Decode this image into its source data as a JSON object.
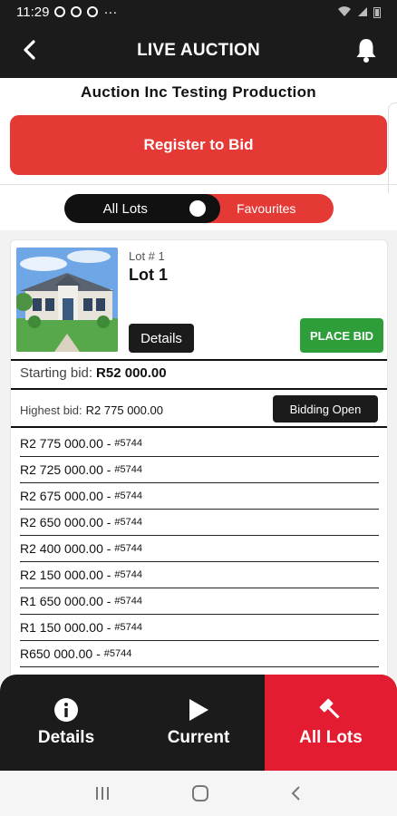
{
  "status_bar": {
    "time": "11:29",
    "more": "···"
  },
  "app_bar": {
    "title": "LIVE AUCTION",
    "back_icon": "back-arrow-icon",
    "bell_icon": "bell-icon"
  },
  "auction_name": "Auction Inc Testing Production",
  "register_button": "Register to Bid",
  "filter_toggle": {
    "left_label": "All Lots",
    "right_label": "Favourites"
  },
  "lot": {
    "number_label": "Lot # 1",
    "name": "Lot 1",
    "details_button": "Details",
    "place_bid_button": "PLACE BID",
    "starting_bid_label": "Starting bid:",
    "starting_bid_value": "R52 000.00",
    "highest_bid_label": "Highest bid:",
    "highest_bid_value": "R2 775 000.00",
    "status_button": "Bidding Open",
    "bids": [
      {
        "amount": "R2 775 000.00",
        "bidder": "#5744"
      },
      {
        "amount": "R2 725 000.00",
        "bidder": "#5744"
      },
      {
        "amount": "R2 675 000.00",
        "bidder": "#5744"
      },
      {
        "amount": "R2 650 000.00",
        "bidder": "#5744"
      },
      {
        "amount": "R2 400 000.00",
        "bidder": "#5744"
      },
      {
        "amount": "R2 150 000.00",
        "bidder": "#5744"
      },
      {
        "amount": "R1 650 000.00",
        "bidder": "#5744"
      },
      {
        "amount": "R1 150 000.00",
        "bidder": "#5744"
      },
      {
        "amount": "R650 000.00",
        "bidder": "#5744"
      }
    ]
  },
  "bottom_nav": [
    {
      "label": "Details",
      "icon": "info-icon",
      "active": false
    },
    {
      "label": "Current",
      "icon": "play-icon",
      "active": false
    },
    {
      "label": "All Lots",
      "icon": "gavel-icon",
      "active": true
    }
  ],
  "colors": {
    "accent_red": "#e53935",
    "dark": "#1b1b1b",
    "green": "#2e9e3a"
  }
}
